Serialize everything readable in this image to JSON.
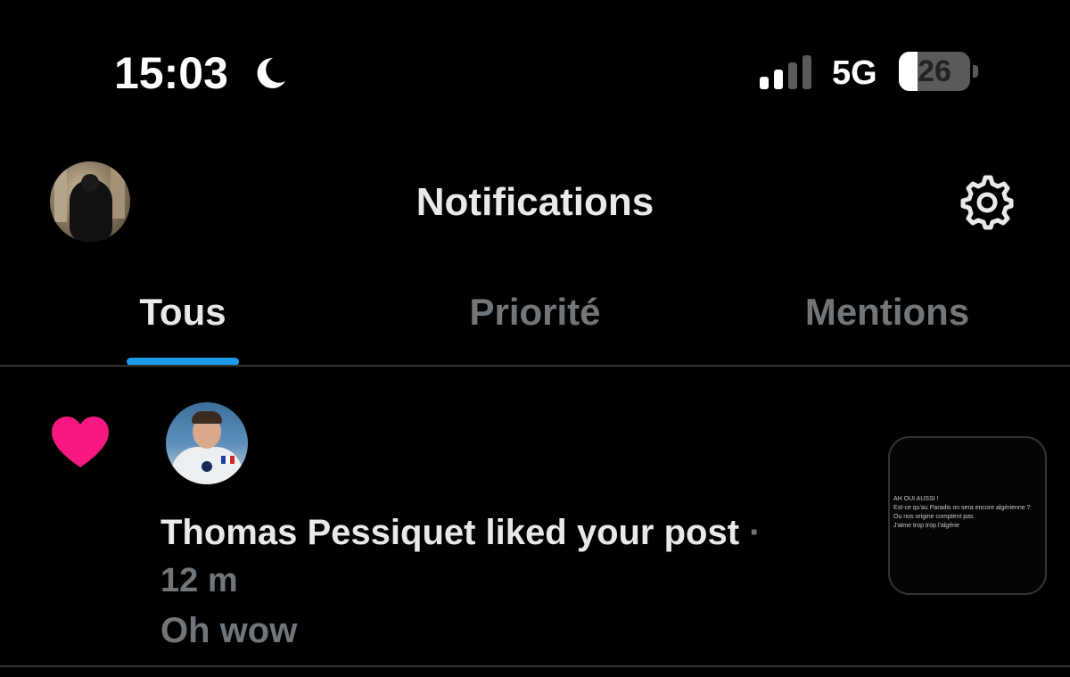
{
  "status_bar": {
    "time": "15:03",
    "focus_mode_icon": "moon-icon",
    "network": "5G",
    "battery_level": "26",
    "battery_fraction": 0.26
  },
  "header": {
    "title": "Notifications",
    "avatar_icon": "profile-avatar",
    "settings_icon": "gear-icon"
  },
  "tabs": [
    {
      "label": "Tous",
      "active": true
    },
    {
      "label": "Priorité",
      "active": false
    },
    {
      "label": "Mentions",
      "active": false
    }
  ],
  "notification": {
    "type_icon": "heart-icon",
    "text": "Thomas Pessiquet liked your post",
    "separator": "·",
    "time": "12 m",
    "snippet": "Oh wow",
    "post_preview_lines": [
      "AH OUI AUSSI !",
      "Est-ce qu'au Paradis on sera encore algérienne ?",
      "Ou nos origine comptent pas",
      "J'aime trop trop l'algérie"
    ]
  },
  "colors": {
    "background": "#000000",
    "accent": "#1d9bf0",
    "like": "#f91880",
    "muted_text": "#71767b",
    "primary_text": "#e7e9ea",
    "divider": "#2f3336"
  }
}
